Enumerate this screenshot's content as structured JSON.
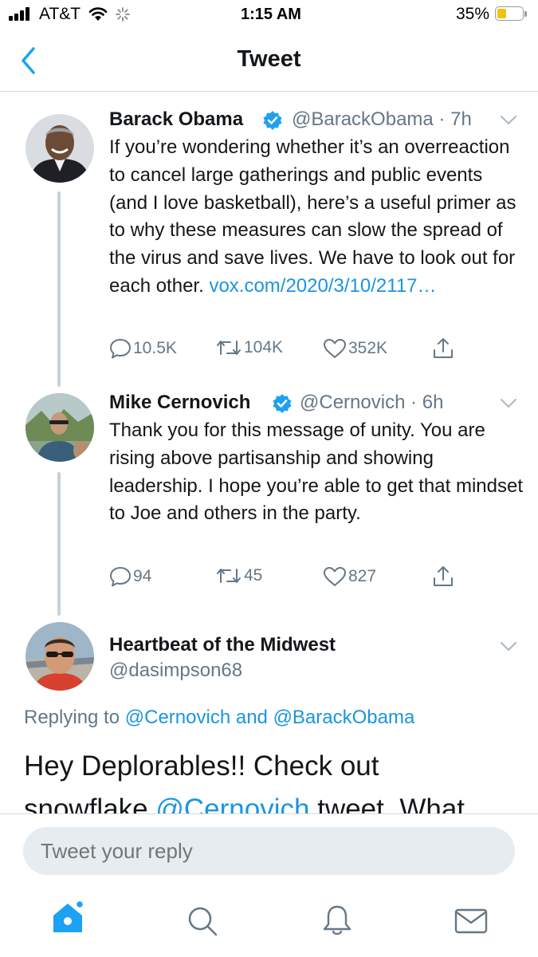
{
  "status_bar": {
    "carrier": "AT&T",
    "time": "1:15 AM",
    "battery": "35%"
  },
  "nav": {
    "title": "Tweet"
  },
  "tweets": [
    {
      "name": "Barack Obama",
      "verified": true,
      "handle": "@BarackObama",
      "time": "7h",
      "text": "If you’re wondering whether it’s an overreaction to cancel large gatherings and public events (and I love basketball), here’s a useful primer as to why these measures can slow the spread of the virus and save lives. We have to look out for each other.",
      "link": "vox.com/2020/3/10/2117…",
      "replies": "10.5K",
      "retweets": "104K",
      "likes": "352K"
    },
    {
      "name": "Mike Cernovich",
      "verified": true,
      "handle": "@Cernovich",
      "time": "6h",
      "text": "Thank you for this message of unity. You are rising above partisanship and showing leadership. I hope you’re able to get that mindset to Joe and others in the party.",
      "replies": "94",
      "retweets": "45",
      "likes": "827"
    }
  ],
  "focused_tweet": {
    "name": "Heartbeat of the Midwest",
    "handle": "@dasimpson68",
    "replying_prefix": "Replying to",
    "replying_user1": "@Cernovich",
    "replying_and": "and",
    "replying_user2": "@BarackObama",
    "text_line1": "Hey Deplorables!! Check out",
    "text_line2_a": "snowflake",
    "text_line2_mention": "@Cernovich",
    "text_line2_b": "tweet. What"
  },
  "reply_box": {
    "placeholder": "Tweet your reply"
  },
  "tab_bar": {
    "items": [
      "home-icon",
      "search-icon",
      "notifications-icon",
      "messages-icon"
    ],
    "active": "home-icon",
    "accent": "#1da1f2"
  },
  "colors": {
    "accent": "#1da1f2",
    "link": "#1b95e0",
    "muted": "#657786"
  }
}
